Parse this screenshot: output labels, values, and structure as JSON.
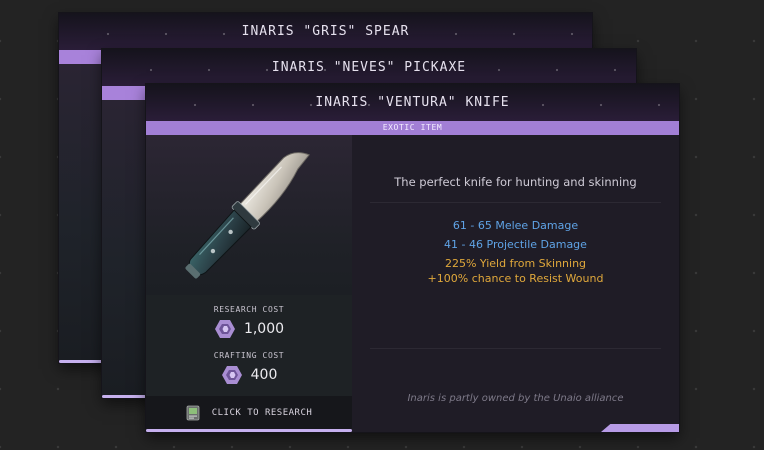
{
  "cards": {
    "back": {
      "title": "INARIS \"GRIS\" SPEAR"
    },
    "middle": {
      "title": "INARIS \"NEVES\" PICKAXE"
    },
    "front": {
      "title": "INARIS \"VENTURA\" KNIFE",
      "rarity": "EXOTIC ITEM",
      "description": "The perfect knife for hunting and skinning",
      "stats": [
        {
          "text": "61 - 65 Melee Damage",
          "color": "#5fa3e6"
        },
        {
          "text": "41 - 46 Projectile Damage",
          "color": "#5fa3e6"
        },
        {
          "text": "225% Yield from Skinning",
          "color": "#e0a83b"
        },
        {
          "text": "+100% chance to Resist Wound",
          "color": "#e0a83b"
        }
      ],
      "research_cost": {
        "label": "RESEARCH COST",
        "value": "1,000"
      },
      "crafting_cost": {
        "label": "CRAFTING COST",
        "value": "400"
      },
      "research_button": "CLICK TO RESEARCH",
      "ownership": "Inaris is partly owned by the Unaio alliance",
      "icons": {
        "item": "knife-icon",
        "cost": "hexagon-resource-icon",
        "button": "research-tablet-icon"
      }
    }
  },
  "colors": {
    "accent_purple": "#a882da",
    "stat_blue": "#5fa3e6",
    "stat_gold": "#e0a83b"
  }
}
